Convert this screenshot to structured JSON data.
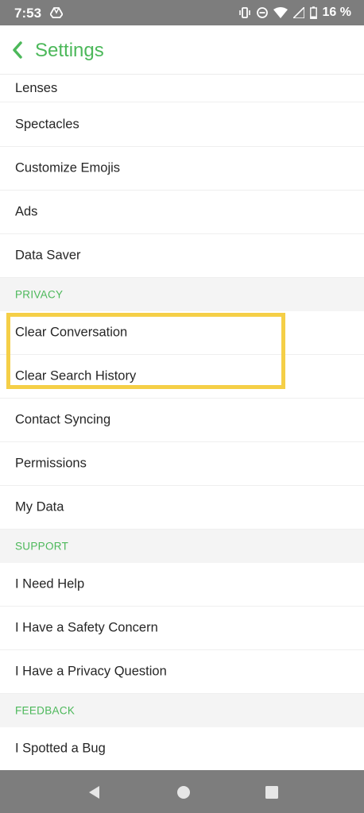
{
  "status_bar": {
    "time": "7:53",
    "battery": "16 %",
    "icons": [
      "drive-icon",
      "vibrate-icon",
      "dnd-icon",
      "wifi-icon",
      "signal-icon",
      "battery-icon"
    ]
  },
  "header": {
    "title": "Settings",
    "back_icon": "chevron-left-icon"
  },
  "items": {
    "lenses": "Lenses",
    "spectacles": "Spectacles",
    "customize_emojis": "Customize Emojis",
    "ads": "Ads",
    "data_saver": "Data Saver",
    "clear_conversation": "Clear Conversation",
    "clear_search_history": "Clear Search History",
    "contact_syncing": "Contact Syncing",
    "permissions": "Permissions",
    "my_data": "My Data",
    "i_need_help": "I Need Help",
    "safety_concern": "I Have a Safety Concern",
    "privacy_question": "I Have a Privacy Question",
    "spotted_bug": "I Spotted a Bug"
  },
  "sections": {
    "privacy": "PRIVACY",
    "support": "SUPPORT",
    "feedback": "FEEDBACK"
  },
  "colors": {
    "accent_green": "#4cb85a",
    "highlight_yellow": "#f5cf47",
    "system_bar_gray": "#7d7d7d"
  },
  "nav_bar": {
    "icons": [
      "back-triangle-icon",
      "home-circle-icon",
      "recents-square-icon"
    ]
  }
}
